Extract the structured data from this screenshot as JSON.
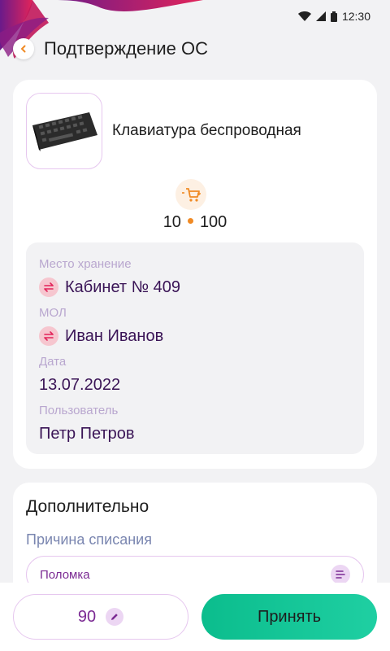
{
  "status_bar": {
    "time": "12:30"
  },
  "header": {
    "title": "Подтверждение ОС"
  },
  "item": {
    "name": "Клавиатура беспроводная",
    "quantity": "10",
    "total": "100"
  },
  "details": {
    "storage_label": "Место хранение",
    "storage_value": "Кабинет № 409",
    "mol_label": "МОЛ",
    "mol_value": "Иван Иванов",
    "date_label": "Дата",
    "date_value": "13.07.2022",
    "user_label": "Пользователь",
    "user_value": "Петр Петров"
  },
  "extra": {
    "title": "Дополнительно",
    "reason_label": "Причина списания",
    "reason_value": "Поломка"
  },
  "bottom": {
    "count_value": "90",
    "accept_label": "Принять"
  },
  "colors": {
    "accent_purple": "#7b2a93",
    "accent_green": "#0bbd8d",
    "accent_orange": "#f08a24"
  }
}
